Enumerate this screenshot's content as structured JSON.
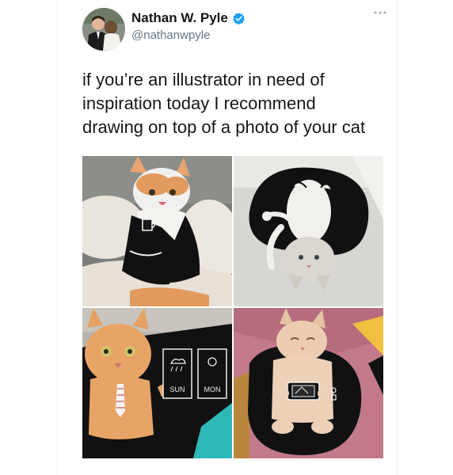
{
  "tweet": {
    "author_name": "Nathan W. Pyle",
    "author_handle": "@nathanwpyle",
    "text_lines": [
      "if you’re an illustrator in need of",
      "inspiration today I recommend",
      "drawing on top of a photo of your cat"
    ]
  },
  "photos": {
    "bottom_left": {
      "label_left": "SUN",
      "label_right": "MON"
    }
  },
  "icons": {
    "verified": "verified-badge-icon",
    "more": "more-dots-icon"
  },
  "colors": {
    "verified": "#1da1f2",
    "text": "#14171a",
    "handle": "#657786"
  }
}
